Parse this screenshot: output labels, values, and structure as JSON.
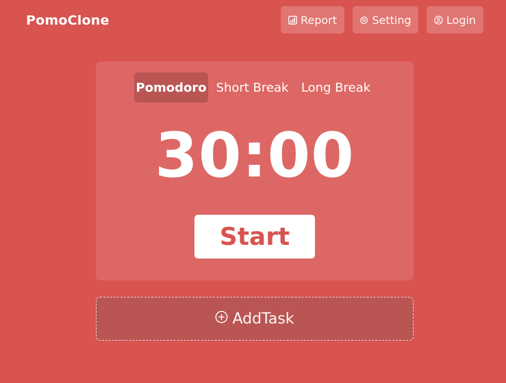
{
  "header": {
    "brand": "PomoClone",
    "nav": {
      "report_label": "Report",
      "report_icon": "report-chart-icon",
      "setting_label": "Setting",
      "setting_icon": "gear-icon",
      "login_label": "Login",
      "login_icon": "user-circle-icon"
    }
  },
  "timer_card": {
    "tabs": [
      "Pomodoro",
      "Short Break",
      "Long Break"
    ],
    "active_tab": "Pomodoro",
    "time": "30:00",
    "start_label": "Start"
  },
  "task": {
    "add_label": "AddTask",
    "add_icon": "plus-circle-icon"
  },
  "colors": {
    "background": "#d9534f",
    "card": "#dd6764",
    "active_tab": "#b95553",
    "text": "#ffffff"
  }
}
